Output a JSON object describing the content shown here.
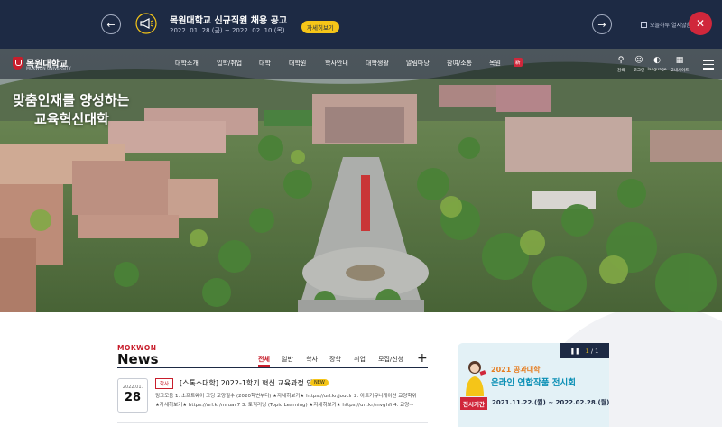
{
  "notice_banner": {
    "title": "목원대학교 신규직원 채용 공고",
    "date": "2022. 01. 28.(금) ~ 2022. 02. 10.(목)",
    "more_label": "자세히보기",
    "today_close_label": "오늘하루 열지않음"
  },
  "nav": {
    "logo_name": "목원대학교",
    "logo_sub": "MOKWON UNIVERSITY",
    "menu": [
      "대학소개",
      "입학/취업",
      "대학",
      "대학원",
      "학사안내",
      "대학생활",
      "알림마당",
      "참여/소통",
      "목원"
    ],
    "menu_badge": "新",
    "utils": [
      {
        "icon": "search-icon",
        "label": "검색"
      },
      {
        "icon": "login-icon",
        "label": "로그인"
      },
      {
        "icon": "globe-icon",
        "label": "language"
      },
      {
        "icon": "sitemap-icon",
        "label": "교내사이트"
      }
    ]
  },
  "hero": {
    "slogan_line1": "맞춤인재를 양성하는",
    "slogan_line2": "교육혁신대학"
  },
  "news": {
    "brand_label": "MOKWON",
    "title": "News",
    "tabs": [
      "전체",
      "일반",
      "학사",
      "장학",
      "취업",
      "모집/신청"
    ],
    "active_tab": "전체",
    "items": [
      {
        "year_month": "2022.01.",
        "day": "28",
        "category": "학사",
        "title": "[스톡스대학] 2022-1학기 혁신 교육과정 안내",
        "badge": "NEW",
        "summary_line1": "링크모음 1. 소프트웨어 코딩 교양필수 (2020학번부터) ★자세히보기★ https://url.kr/jouclr  2. 아트커뮤니케이션 교양학위",
        "summary_line2": "★자세히보기★ https://url.kr/mruav7  3. 토픽러닝 (Topic Learning) ★자세히보기★ https://url.kr/mvghfi  4. 교양···"
      }
    ]
  },
  "popup": {
    "current": "1",
    "total": "1",
    "year_label": "2021 공과대학",
    "event_title": "온라인 연합작품 전시회",
    "tag": "전시기간",
    "period": "2021.11.22.(월) ~ 2022.02.28.(월)"
  },
  "colors": {
    "banner_bg": "#1d2a44",
    "accent_red": "#d0273b",
    "badge_yellow": "#f5c518"
  }
}
